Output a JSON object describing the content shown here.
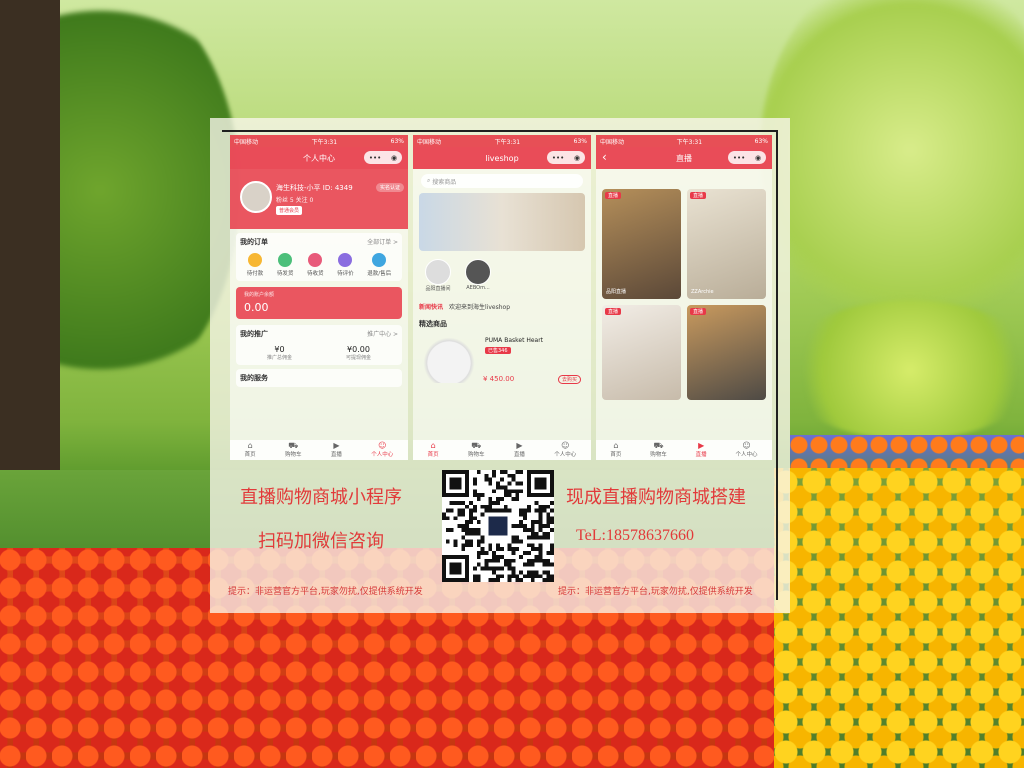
{
  "phone1": {
    "status_left": "中国移动",
    "status_time": "下午3:31",
    "status_right": "63%",
    "title": "个人中心",
    "user_name": "海生科技-小平",
    "user_id_label": "ID",
    "user_id": "4349",
    "user_meta": "粉丝 5  关注 0",
    "user_tag": "普通会员",
    "badge": "实名认证",
    "orders_title": "我的订单",
    "orders_more": "全部订单 >",
    "order_icons": [
      "待付款",
      "待发货",
      "待收货",
      "待评价",
      "退款/售后"
    ],
    "order_colors": [
      "#f7b733",
      "#4cbf7a",
      "#e85a7a",
      "#8a6de0",
      "#3fa6e0"
    ],
    "wallet_label": "我的账户余额",
    "wallet_amount": "0.00",
    "promo_title": "我的推广",
    "promo_more": "推广中心 >",
    "stat1_value": "¥0",
    "stat1_label": "推广总佣金",
    "stat2_value": "¥0.00",
    "stat2_label": "可提现佣金",
    "service_title": "我的服务",
    "tabs": [
      "首页",
      "购物车",
      "直播",
      "个人中心"
    ]
  },
  "phone2": {
    "status_left": "中国移动",
    "status_time": "下午3:31",
    "status_right": "63%",
    "title": "liveshop",
    "search_placeholder": "搜索商品",
    "anchor1": "品阳直播间",
    "anchor2": "AEBOm...",
    "news_label": "新闻快讯",
    "news_text": "欢迎来到海生liveshop",
    "select_title": "精选商品",
    "product_name": "PUMA Basket Heart",
    "product_tag": "已售346",
    "product_price": "¥ 450.00",
    "product_button": "去购买",
    "tabs": [
      "首页",
      "购物车",
      "直播",
      "个人中心"
    ]
  },
  "phone3": {
    "status_left": "中国移动",
    "status_time": "下午3:31",
    "status_right": "63%",
    "title": "直播",
    "live_tag": "直播",
    "card1_name": "品阳直播",
    "card2_name": "ZZArchie",
    "tabs": [
      "首页",
      "购物车",
      "直播",
      "个人中心"
    ]
  },
  "promo": {
    "left_line1": "直播购物商城小程序",
    "left_line2": "扫码加微信咨询",
    "right_line1": "现成直播购物商城搭建",
    "right_line2": "TeL:18578637660",
    "note_left": "提示：非运营官方平台,玩家勿扰,仅提供系统开发",
    "note_right": "提示：非运营官方平台,玩家勿扰,仅提供系统开发"
  },
  "colors": {
    "brand_red": "#e83948",
    "promo_red": "#e23a3a"
  }
}
